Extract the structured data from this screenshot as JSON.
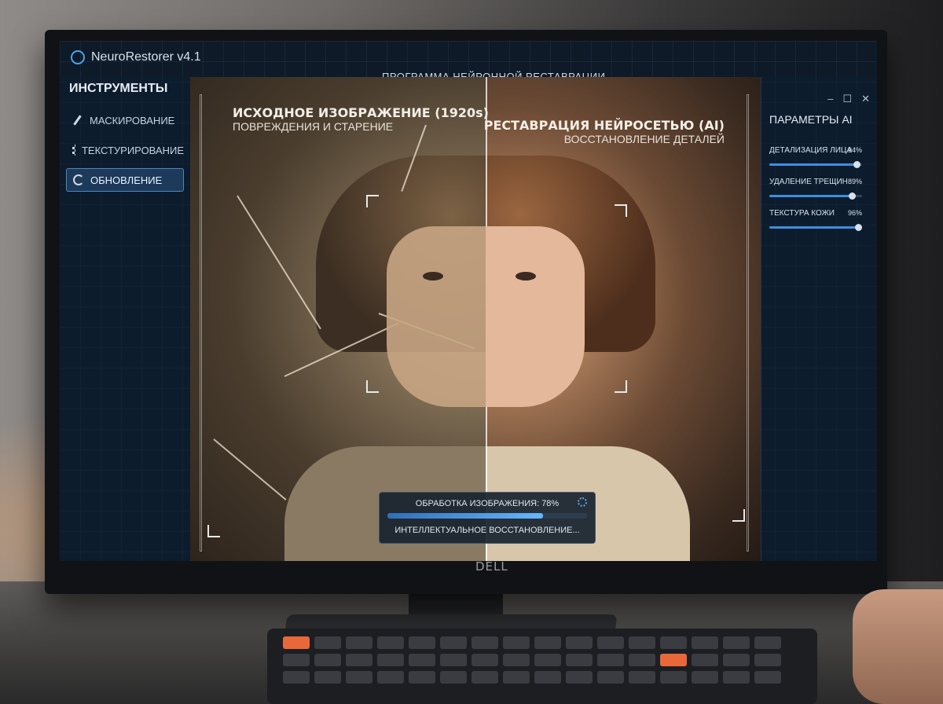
{
  "app": {
    "name": "NeuroRestorer v4.1",
    "window_title": "ПРОГРАММА НЕЙРОННОЙ РЕСТАВРАЦИИ",
    "window_controls": [
      "–",
      "☐",
      "✕"
    ]
  },
  "sidebar": {
    "title": "ИНСТРУМЕНТЫ",
    "items": [
      {
        "label": "МАСКИРОВАНИЕ",
        "icon": "brush-icon",
        "active": false
      },
      {
        "label": "ТЕКСТУРИРОВАНИЕ",
        "icon": "texture-icon",
        "active": false
      },
      {
        "label": "ОБНОВЛЕНИЕ",
        "icon": "refresh-icon",
        "active": true
      }
    ]
  },
  "viewer": {
    "left_title": "ИСХОДНОЕ ИЗОБРАЖЕНИЕ (1920s)",
    "left_subtitle": "ПОВРЕЖДЕНИЯ И СТАРЕНИЕ",
    "right_title": "РЕСТАВРАЦИЯ НЕЙРОСЕТЬЮ (AI)",
    "right_subtitle": "ВОССТАНОВЛЕНИЕ ДЕТАЛЕЙ"
  },
  "params": {
    "title": "ПАРАМЕТРЫ AI",
    "items": [
      {
        "label": "ДЕТАЛИЗАЦИЯ ЛИЦА",
        "value_text": "94%",
        "value": 0.94
      },
      {
        "label": "УДАЛЕНИЕ ТРЕЩИН",
        "value_text": "89%",
        "value": 0.89
      },
      {
        "label": "ТЕКСТУРА КОЖИ",
        "value_text": "96%",
        "value": 0.96
      }
    ]
  },
  "progress": {
    "label": "ОБРАБОТКА ИЗОБРАЖЕНИЯ: 78%",
    "value": 0.78,
    "status": "ИНТЕЛЛЕКТУАЛЬНОЕ ВОССТАНОВЛЕНИЕ..."
  },
  "monitor": {
    "brand": "DELL"
  },
  "colors": {
    "accent": "#3f8ee0",
    "panel": "#0e1a28"
  }
}
